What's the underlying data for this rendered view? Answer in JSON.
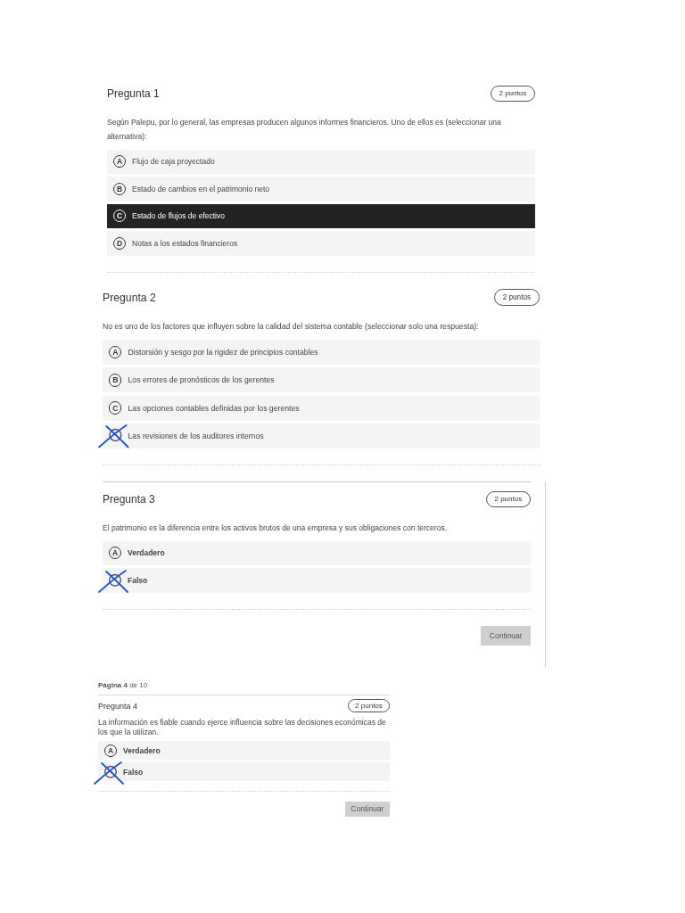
{
  "panels": [
    {
      "question": {
        "title": "Pregunta 1",
        "points": "2 puntos",
        "kind": "multiple_choice",
        "prompt": "Según Palepu, por lo general, las empresas producen algunos informes financieros. Uno de ellos es (seleccionar una alternativa):",
        "options": [
          {
            "letter": "A",
            "text": "Flujo de caja proyectado",
            "selected": false,
            "crossed_out": false
          },
          {
            "letter": "B",
            "text": "Estado de cambios en el patrimonio neto",
            "selected": false,
            "crossed_out": false
          },
          {
            "letter": "C",
            "text": "Estado de flujos de efectivo",
            "selected": true,
            "crossed_out": false
          },
          {
            "letter": "D",
            "text": "Notas a los estados financieros",
            "selected": false,
            "crossed_out": false
          }
        ]
      }
    },
    {
      "question": {
        "title": "Pregunta 2",
        "points": "2 puntos",
        "kind": "multiple_choice",
        "prompt": "No es uno de los factores que influyen sobre la calidad del sistema contable (seleccionar solo una respuesta):",
        "options": [
          {
            "letter": "A",
            "text": "Distorsión y sesgo por la rigidez de principios contables",
            "selected": false,
            "crossed_out": false
          },
          {
            "letter": "B",
            "text": "Los errores de pronósticos de los gerentes",
            "selected": false,
            "crossed_out": false
          },
          {
            "letter": "C",
            "text": "Las opciones contables definidas por los gerentes",
            "selected": false,
            "crossed_out": false
          },
          {
            "text": "Las revisiones de los auditores internos",
            "selected": false,
            "crossed_out": true
          }
        ]
      }
    },
    {
      "question": {
        "title": "Pregunta 3",
        "points": "2 puntos",
        "kind": "true_false",
        "prompt": "El patrimonio es la diferencia entre los activos brutos de una empresa y sus obligaciones con terceros.",
        "options": [
          {
            "letter": "A",
            "text": "Verdadero",
            "selected": false,
            "crossed_out": false
          },
          {
            "text": "Falso",
            "selected": false,
            "crossed_out": true
          }
        ]
      },
      "continue_button": "Continuar"
    },
    {
      "page_indicator": "**Página 4** de 10",
      "question": {
        "title": "Pregunta 4",
        "points": "2 puntos",
        "kind": "true_false",
        "prompt": "La información es fiable cuando ejerce influencia sobre las decisiones económicas de los que la utilizan.",
        "options": [
          {
            "letter": "A",
            "text": "Verdadero",
            "selected": false,
            "crossed_out": false
          },
          {
            "text": "Falso",
            "selected": false,
            "crossed_out": true
          }
        ]
      },
      "continue_button": "Continuar"
    }
  ]
}
